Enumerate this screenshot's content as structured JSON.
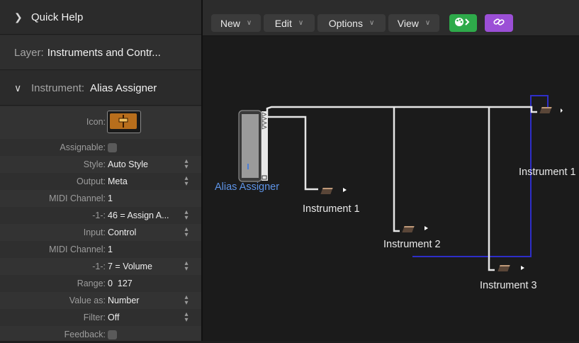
{
  "inspector": {
    "quick_help": "Quick Help",
    "layer_label": "Layer:",
    "layer_value": "Instruments and Contr...",
    "instrument_label": "Instrument:",
    "instrument_value": "Alias Assigner",
    "params": [
      {
        "label": "Icon:",
        "kind": "icon"
      },
      {
        "label": "Assignable:",
        "kind": "checkbox",
        "checked": false
      },
      {
        "label": "Style:",
        "value": "Auto Style",
        "stepper": true
      },
      {
        "label": "Output:",
        "value": "Meta",
        "stepper": true
      },
      {
        "label": "MIDI Channel:",
        "value": "1",
        "stepper": false
      },
      {
        "label": "-1-:",
        "value": "46 = Assign A...",
        "stepper": true
      },
      {
        "label": "Input:",
        "value": "Control",
        "stepper": true
      },
      {
        "label": "MIDI Channel:",
        "value": "1",
        "stepper": false
      },
      {
        "label": "-1-:",
        "value": "7 = Volume",
        "stepper": true
      },
      {
        "label": "Range:",
        "value": "0  127",
        "stepper": false
      },
      {
        "label": "Value as:",
        "value": "Number",
        "stepper": true
      },
      {
        "label": "Filter:",
        "value": "Off",
        "stepper": true
      },
      {
        "label": "Feedback:",
        "kind": "checkbox",
        "checked": false
      }
    ]
  },
  "toolbar": {
    "new_label": "New",
    "edit_label": "Edit",
    "options_label": "Options",
    "view_label": "View",
    "green_button_icon": "palette-icon",
    "purple_button_icon": "link-icon",
    "green_color": "#2eaa4a",
    "purple_color": "#9b4fd6"
  },
  "canvas": {
    "alias_assigner_label": "Alias Assigner",
    "instruments": [
      {
        "label": "Instrument 1"
      },
      {
        "label": "Instrument 2"
      },
      {
        "label": "Instrument 3"
      },
      {
        "label": "Instrument 1"
      }
    ],
    "cable_color": "#e6e6e6",
    "link_color": "#2e2ec8"
  }
}
